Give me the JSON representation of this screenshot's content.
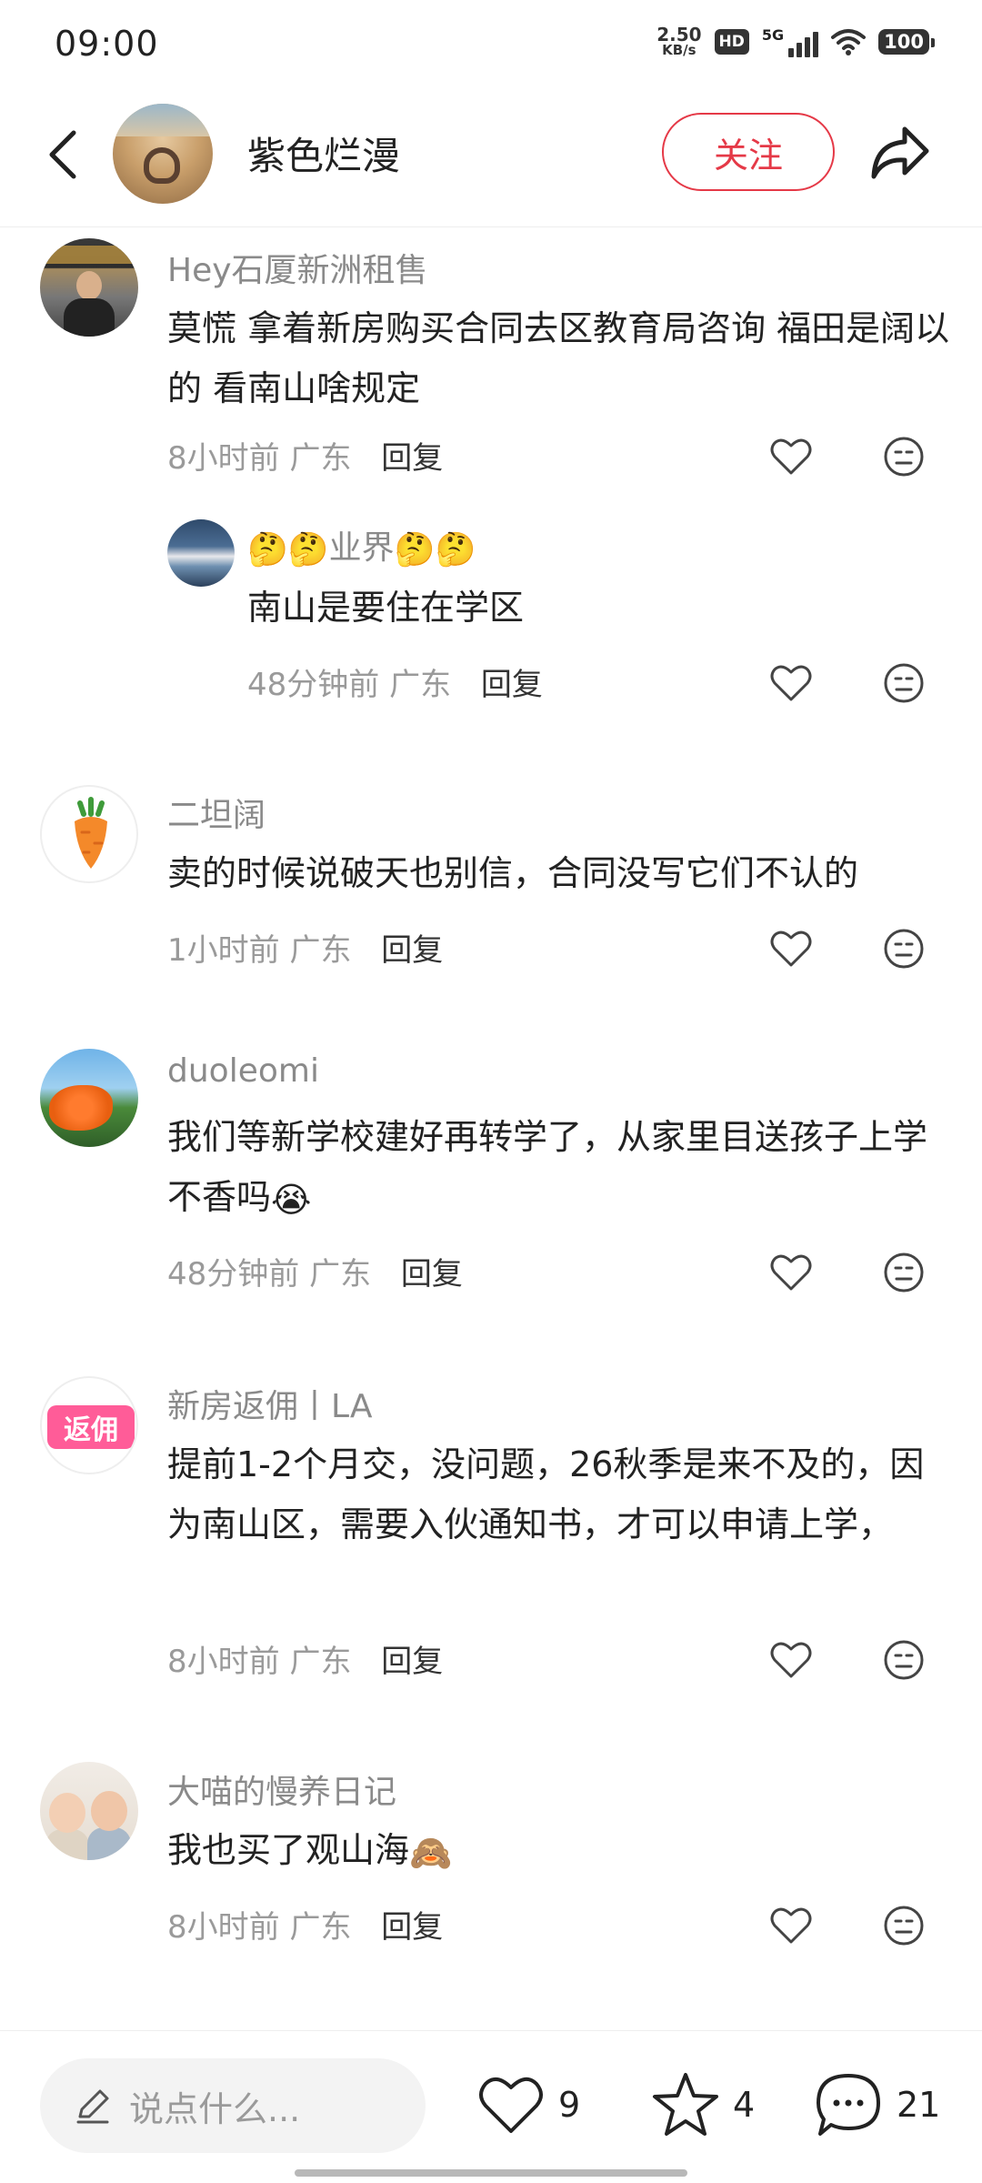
{
  "status_bar": {
    "time": "09:00",
    "net_speed_value": "2.50",
    "net_speed_unit": "KB/s",
    "hd": "HD",
    "network": "5G",
    "battery": "100"
  },
  "header": {
    "author_name": "紫色烂漫",
    "follow_label": "关注"
  },
  "comments": [
    {
      "user": "Hey石厦新洲租售",
      "text": "莫慌 拿着新房购买合同去区教育局咨询 福田是阔以的 看南山啥规定",
      "time": "8小时前",
      "location": "广东",
      "reply_label": "回复"
    },
    {
      "user_emoji_prefix": "🤔🤔",
      "user_core": "业界",
      "user_emoji_suffix": "🤔🤔",
      "text": "南山是要住在学区",
      "time": "48分钟前",
      "location": "广东",
      "reply_label": "回复"
    },
    {
      "user": "二坦阔",
      "text": "卖的时候说破天也别信，合同没写它们不认的",
      "time": "1小时前",
      "location": "广东",
      "reply_label": "回复"
    },
    {
      "user": "duoleomi",
      "text": "我们等新学校建好再转学了，从家里目送孩子上学不香吗",
      "text_emoji": "😭",
      "time": "48分钟前",
      "location": "广东",
      "reply_label": "回复"
    },
    {
      "user": "新房返佣丨LA",
      "avatar_badge": "返佣",
      "text": "提前1-2个月交，没问题，26秋季是来不及的，因为南山区，需要入伙通知书，才可以申请上学，",
      "time": "8小时前",
      "location": "广东",
      "reply_label": "回复"
    },
    {
      "user": "大喵的慢养日记",
      "text": "我也买了观山海",
      "text_emoji": "🙈",
      "time": "8小时前",
      "location": "广东",
      "reply_label": "回复"
    }
  ],
  "bottom_bar": {
    "input_placeholder": "说点什么...",
    "like_count": "9",
    "collect_count": "4",
    "comment_count": "21"
  }
}
